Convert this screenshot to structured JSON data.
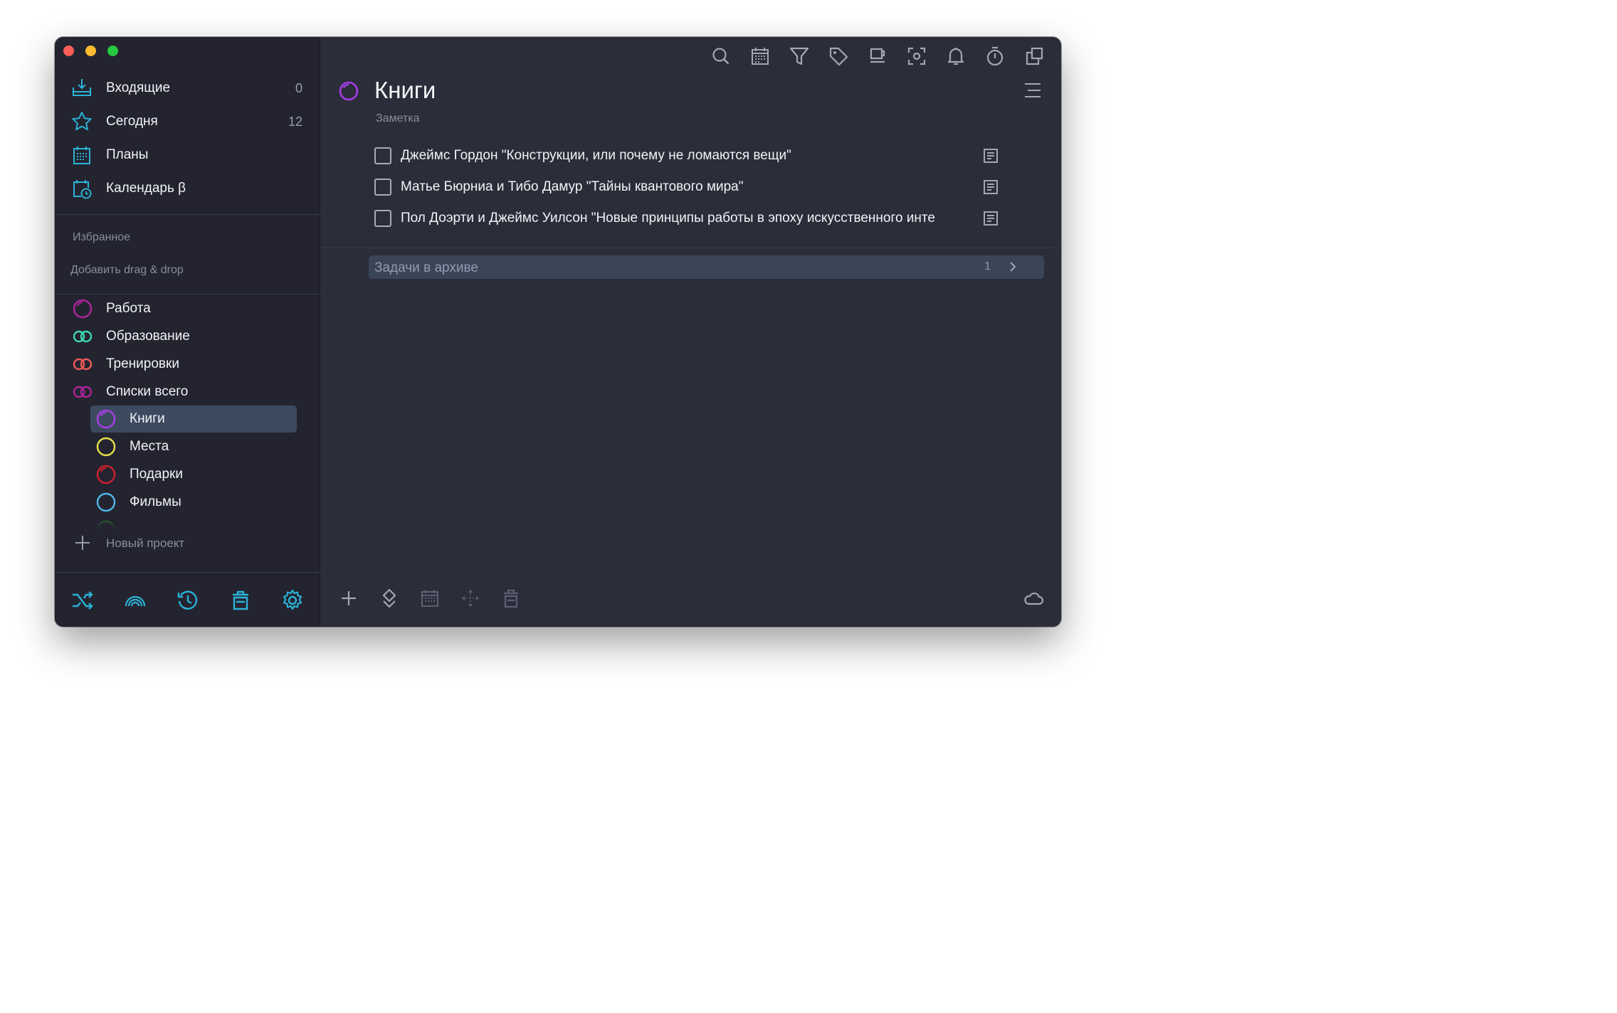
{
  "sidebar": {
    "nav": [
      {
        "label": "Входящие",
        "count": "0"
      },
      {
        "label": "Сегодня",
        "count": "12"
      },
      {
        "label": "Планы",
        "count": ""
      },
      {
        "label": "Календарь β",
        "count": ""
      }
    ],
    "favorites_title": "Избранное",
    "favorites_hint": "Добавить drag & drop",
    "projects": [
      {
        "label": "Работа",
        "color": "#b0239a"
      },
      {
        "label": "Образование",
        "color": "#3fd9b4"
      },
      {
        "label": "Тренировки",
        "color": "#f0595a"
      },
      {
        "label": "Списки всего",
        "color": "#b0239a"
      }
    ],
    "subprojects": [
      {
        "label": "Книги",
        "color": "#a93de8",
        "selected": true
      },
      {
        "label": "Места",
        "color": "#e8e04a"
      },
      {
        "label": "Подарки",
        "color": "#d0202e"
      },
      {
        "label": "Фильмы",
        "color": "#4fb7ea"
      }
    ],
    "new_project_label": "Новый проект"
  },
  "main": {
    "title": "Книги",
    "subtitle": "Заметка",
    "tasks": [
      {
        "text": "Джеймс Гордон \"Конструкции, или почему не ломаются вещи\""
      },
      {
        "text": "Матье Бюрниа и Тибо Дамур \"Тайны квантового мира\""
      },
      {
        "text": "Пол Доэрти и Джеймс Уилсон \"Новые принципы работы в эпоху искусственного инте"
      }
    ],
    "archive": {
      "label": "Задачи в архиве",
      "count": "1"
    }
  },
  "colors": {
    "accent": "#2bb3d6",
    "background": "#2b2d3a",
    "sidebar": "#232430",
    "selected": "#3c4a60"
  },
  "icons": {
    "toolbar": [
      "search-icon",
      "calendar-icon",
      "filter-icon",
      "tag-icon",
      "coffee-icon",
      "focus-icon",
      "bell-icon",
      "timer-icon",
      "copy-icon"
    ],
    "sidebar_bottom": [
      "shuffle-icon",
      "rainbow-icon",
      "history-icon",
      "trash-icon",
      "settings-icon"
    ],
    "main_bottom": [
      "add-icon",
      "priority-icon",
      "calendar-icon",
      "move-icon",
      "trash-icon",
      "cloud-icon"
    ]
  }
}
